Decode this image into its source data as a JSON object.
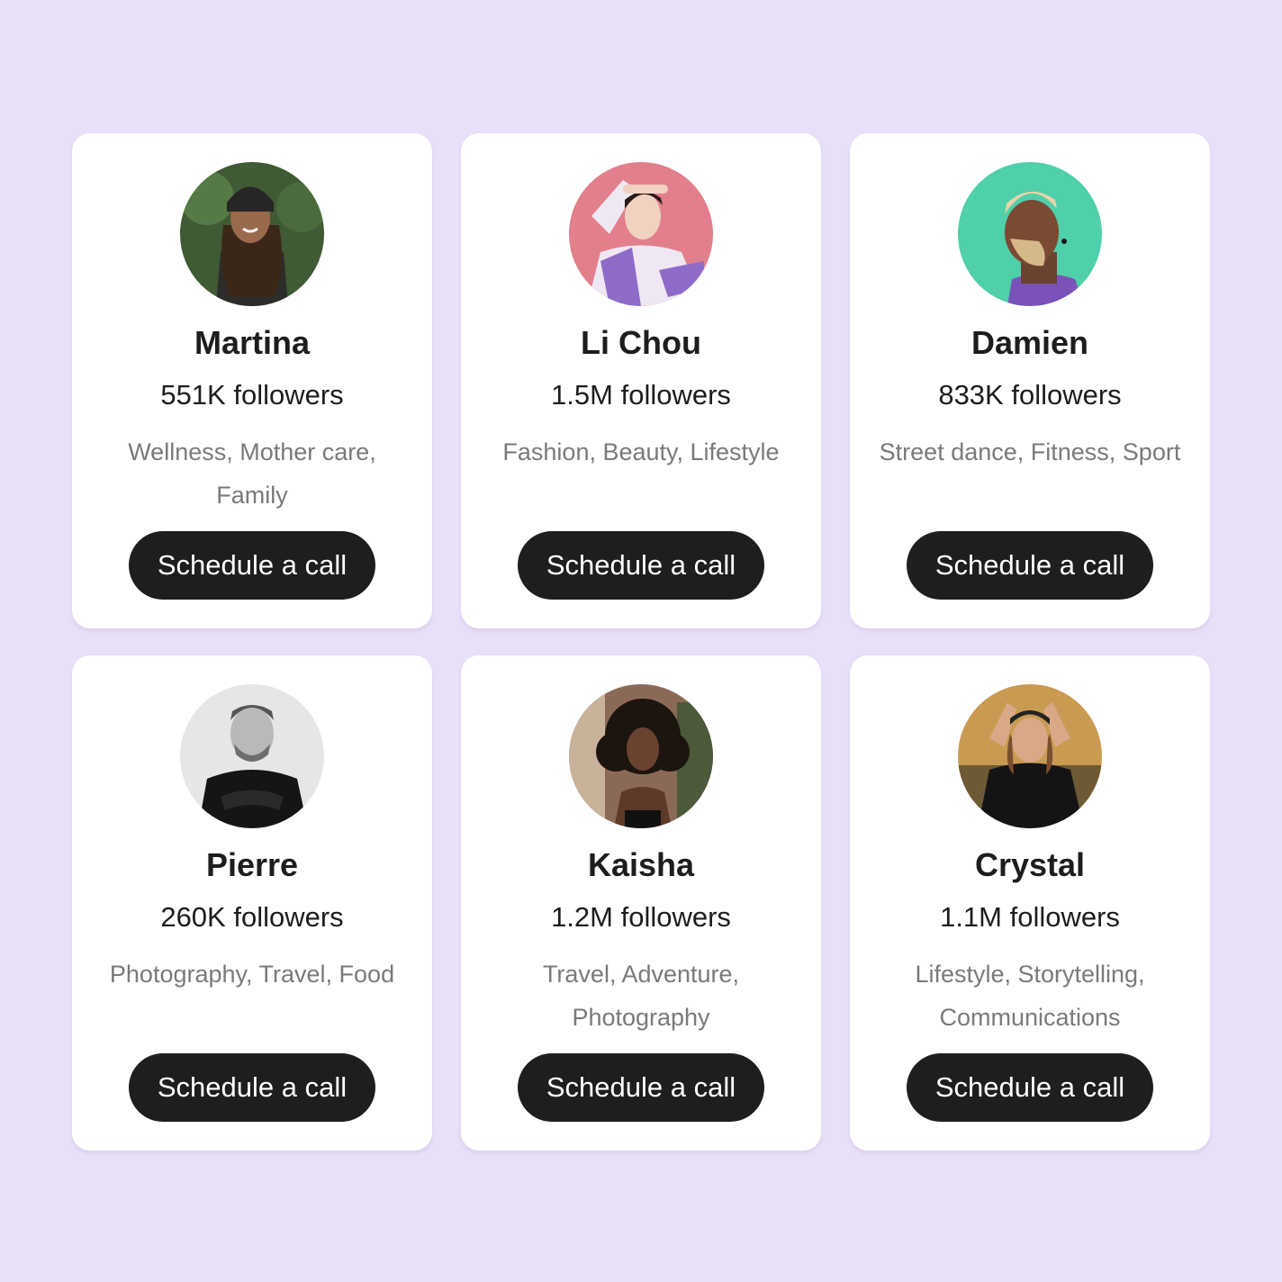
{
  "profiles": [
    {
      "name": "Martina",
      "followers": "551K followers",
      "tags": "Wellness, Mother care, Family",
      "button_label": "Schedule a call"
    },
    {
      "name": "Li Chou",
      "followers": "1.5M followers",
      "tags": "Fashion, Beauty, Lifestyle",
      "button_label": "Schedule a call"
    },
    {
      "name": "Damien",
      "followers": "833K followers",
      "tags": "Street dance, Fitness, Sport",
      "button_label": "Schedule a call"
    },
    {
      "name": "Pierre",
      "followers": "260K followers",
      "tags": "Photography, Travel, Food",
      "button_label": "Schedule a call"
    },
    {
      "name": "Kaisha",
      "followers": "1.2M followers",
      "tags": "Travel, Adventure, Photography",
      "button_label": "Schedule a call"
    },
    {
      "name": "Crystal",
      "followers": "1.1M followers",
      "tags": "Lifestyle, Storytelling, Communications",
      "button_label": "Schedule a call"
    }
  ],
  "colors": {
    "page_background": "#e8dff8",
    "card_background": "#ffffff",
    "button_background": "#1e1e1e",
    "button_text": "#ffffff",
    "name_text": "#1d1d1d",
    "tags_text": "#7a7a7a"
  }
}
